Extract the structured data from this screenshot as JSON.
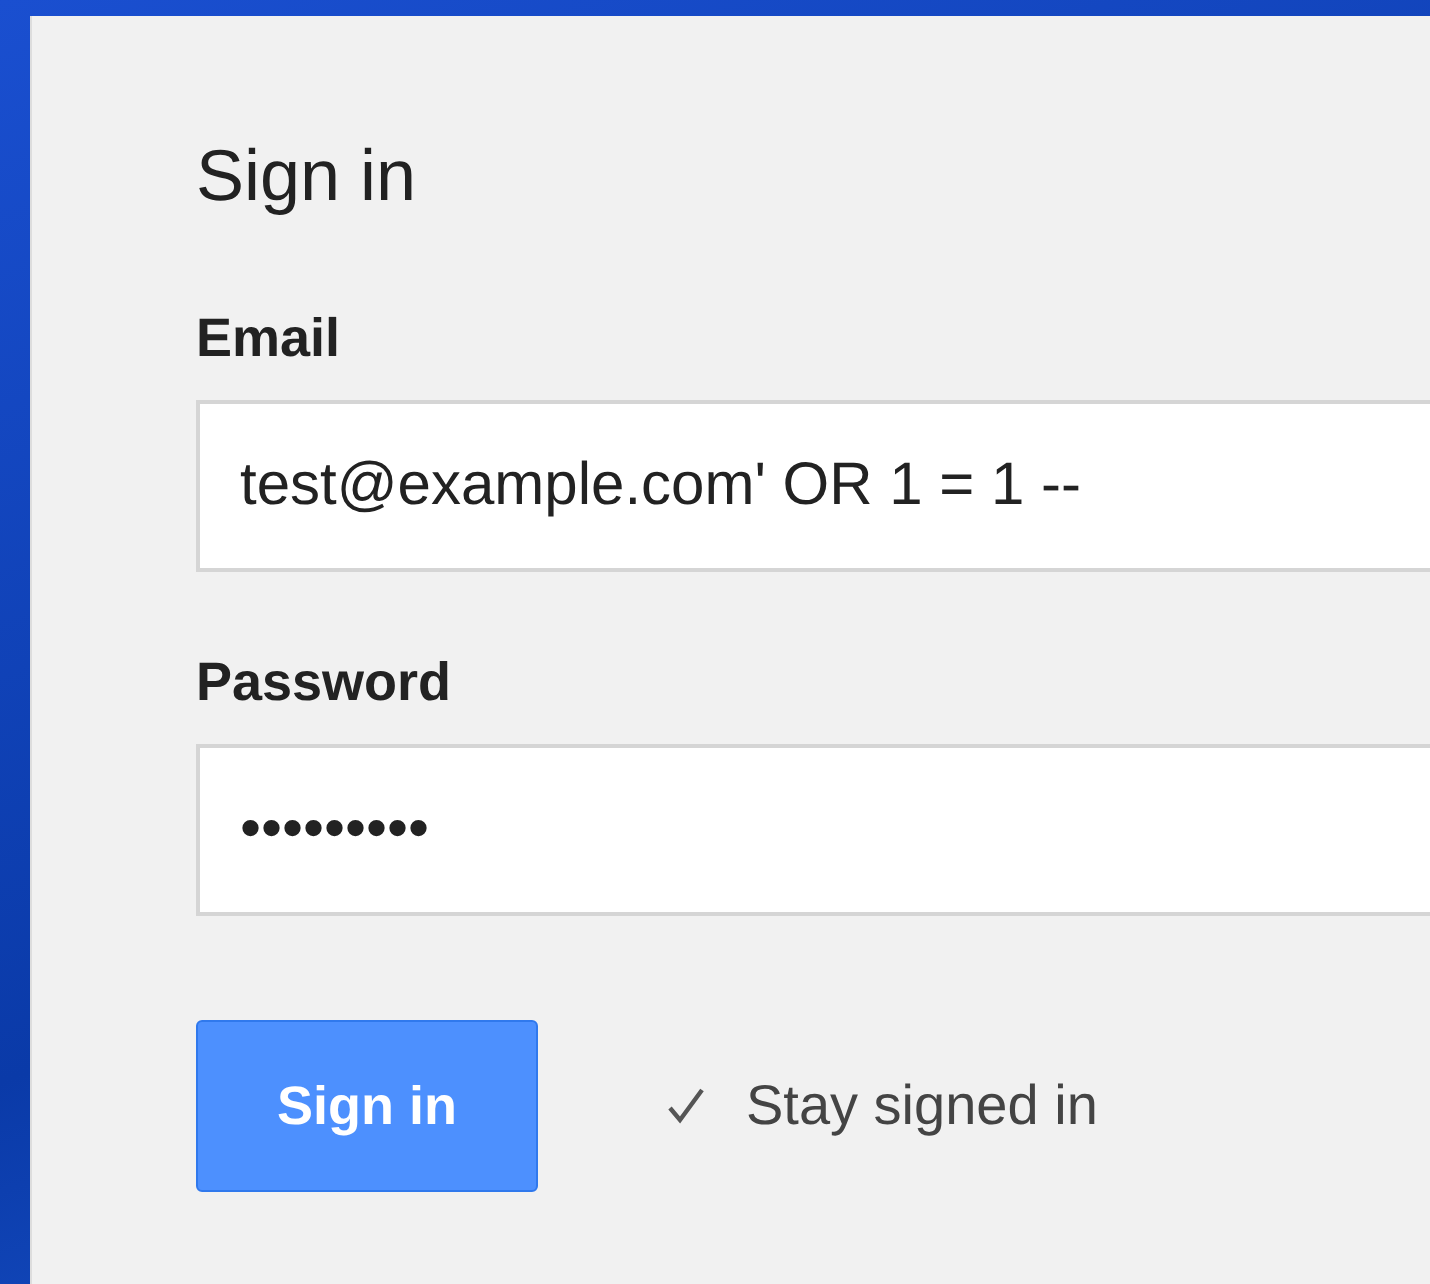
{
  "form": {
    "title": "Sign in",
    "fields": [
      {
        "label": "Email",
        "value": "test@example.com' OR 1 = 1 --"
      },
      {
        "label": "Password",
        "value": "•••••••••"
      }
    ],
    "submit": "Sign in",
    "stay_signed_in": {
      "label": "Stay signed in",
      "checked": true
    }
  }
}
